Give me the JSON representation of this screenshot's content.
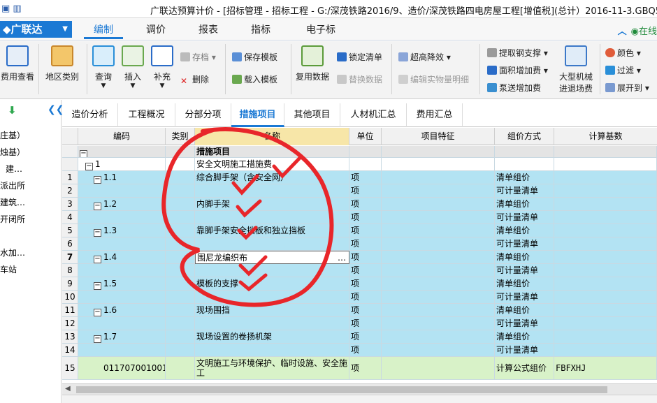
{
  "window": {
    "title": "广联达预算计价 - [招标管理 - 招标工程 - G:/深茂铁路2016/9、造价/深茂铁路四电房屋工程[增值税](总计）2016-11-3.GBQ5]"
  },
  "menubar": {
    "brand": "广联达",
    "tabs": [
      "编制",
      "调价",
      "报表",
      "指标",
      "电子标"
    ],
    "active_tab": "编制",
    "right_text": "在线"
  },
  "ribbon": {
    "fee_view": "费用查看",
    "region_category": "地区类别",
    "query": "查询",
    "insert": "插入",
    "supplement": "补充",
    "archive": "存档",
    "delete": "删除",
    "save_template": "保存模板",
    "load_template": "载入模板",
    "reuse_data": "复用数据",
    "replace_data": "替换数据",
    "lock_list": "锁定清单",
    "overheight_reduce": "超高降效",
    "edit_detail": "编辑实物量明细",
    "extract_steel": "提取钢支撑",
    "area_increase": "面积增加费",
    "pump_increase": "泵送增加费",
    "large_machine": [
      "大型机械",
      "进退场费"
    ],
    "color": "颜色",
    "filter": "过滤",
    "expand_to": "展开到"
  },
  "left_panel": {
    "items": [
      "庄基）",
      "烛基）",
      "建…",
      "派出所",
      "建筑…",
      "开闭所",
      "水加…",
      "车站"
    ]
  },
  "subtabs": [
    "造价分析",
    "工程概况",
    "分部分项",
    "措施项目",
    "其他项目",
    "人材机汇总",
    "费用汇总"
  ],
  "active_subtab": "措施项目",
  "grid": {
    "headers": [
      "编码",
      "类别",
      "名称",
      "单位",
      "项目特征",
      "组价方式",
      "计算基数"
    ],
    "rows": [
      {
        "num": "",
        "code": "",
        "cat": "",
        "name": "措施项目",
        "unit": "",
        "feature": "",
        "method": "",
        "base": "",
        "style": "top"
      },
      {
        "num": "",
        "code": "1",
        "cat": "",
        "name": "安全文明施工措施费",
        "unit": "",
        "feature": "",
        "method": "",
        "base": "",
        "style": "sec"
      },
      {
        "num": "1",
        "code": "1.1",
        "cat": "",
        "name": "综合脚手架（含安全网）",
        "unit": "项",
        "feature": "",
        "method": "清单组价",
        "base": "",
        "style": "item"
      },
      {
        "num": "2",
        "code": "",
        "cat": "",
        "name": "",
        "unit": "项",
        "feature": "",
        "method": "可计量清单",
        "base": "",
        "style": "item"
      },
      {
        "num": "3",
        "code": "1.2",
        "cat": "",
        "name": "内脚手架",
        "unit": "项",
        "feature": "",
        "method": "清单组价",
        "base": "",
        "style": "item"
      },
      {
        "num": "4",
        "code": "",
        "cat": "",
        "name": "",
        "unit": "项",
        "feature": "",
        "method": "可计量清单",
        "base": "",
        "style": "item"
      },
      {
        "num": "5",
        "code": "1.3",
        "cat": "",
        "name": "靠脚手架安全挡板和独立挡板",
        "unit": "项",
        "feature": "",
        "method": "清单组价",
        "base": "",
        "style": "item"
      },
      {
        "num": "6",
        "code": "",
        "cat": "",
        "name": "",
        "unit": "项",
        "feature": "",
        "method": "可计量清单",
        "base": "",
        "style": "item"
      },
      {
        "num": "7",
        "code": "1.4",
        "cat": "",
        "name": "围尼龙编织布",
        "unit": "项",
        "feature": "",
        "method": "清单组价",
        "base": "",
        "style": "item",
        "selected": true
      },
      {
        "num": "8",
        "code": "",
        "cat": "",
        "name": "",
        "unit": "项",
        "feature": "",
        "method": "可计量清单",
        "base": "",
        "style": "item"
      },
      {
        "num": "9",
        "code": "1.5",
        "cat": "",
        "name": "模板的支撑",
        "unit": "项",
        "feature": "",
        "method": "清单组价",
        "base": "",
        "style": "item"
      },
      {
        "num": "10",
        "code": "",
        "cat": "",
        "name": "",
        "unit": "项",
        "feature": "",
        "method": "可计量清单",
        "base": "",
        "style": "item"
      },
      {
        "num": "11",
        "code": "1.6",
        "cat": "",
        "name": "现场围挡",
        "unit": "项",
        "feature": "",
        "method": "清单组价",
        "base": "",
        "style": "item"
      },
      {
        "num": "12",
        "code": "",
        "cat": "",
        "name": "",
        "unit": "项",
        "feature": "",
        "method": "可计量清单",
        "base": "",
        "style": "item"
      },
      {
        "num": "13",
        "code": "1.7",
        "cat": "",
        "name": "现场设置的卷扬机架",
        "unit": "项",
        "feature": "",
        "method": "清单组价",
        "base": "",
        "style": "item"
      },
      {
        "num": "14",
        "code": "",
        "cat": "",
        "name": "",
        "unit": "项",
        "feature": "",
        "method": "可计量清单",
        "base": "",
        "style": "item"
      },
      {
        "num": "15",
        "code": "011707001001",
        "cat": "",
        "name": "文明施工与环境保护、临时设施、安全施工",
        "unit": "项",
        "feature": "",
        "method": "计算公式组价",
        "base": "FBFXHJ",
        "style": "green"
      }
    ]
  },
  "colors": {
    "accent": "#1b79d4",
    "row_blue": "#b3e3f3",
    "row_green": "#d8f2c8",
    "annotation_red": "#e8262a"
  }
}
